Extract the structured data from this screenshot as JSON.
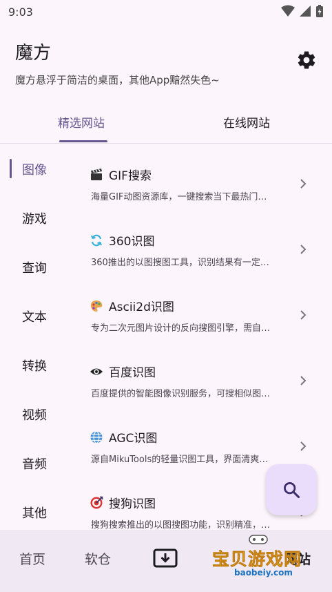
{
  "status_bar": {
    "time": "9:03"
  },
  "header": {
    "title": "魔方",
    "subtitle": "魔方悬浮于简洁的桌面，其他App黯然失色~"
  },
  "tabs": [
    {
      "label": "精选网站",
      "active": true
    },
    {
      "label": "在线网站",
      "active": false
    }
  ],
  "sidebar": {
    "items": [
      {
        "label": "图像",
        "active": true
      },
      {
        "label": "游戏"
      },
      {
        "label": "查询"
      },
      {
        "label": "文本"
      },
      {
        "label": "转换"
      },
      {
        "label": "视频"
      },
      {
        "label": "音频"
      },
      {
        "label": "其他"
      }
    ]
  },
  "list": [
    {
      "icon": "clapper-board-icon",
      "title": "GIF搜索",
      "desc": "海量GIF动图资源库，一键搜索当下最热门…"
    },
    {
      "icon": "refresh-arrows-icon",
      "title": "360识图",
      "desc": "360推出的以图搜图工具，识别结果有一定…"
    },
    {
      "icon": "artist-palette-icon",
      "title": "Ascii2d识图",
      "desc": "专为二次元图片设计的反向搜图引擎，需自…"
    },
    {
      "icon": "eye-icon",
      "title": "百度识图",
      "desc": "百度提供的智能图像识别服务，可搜相似图…"
    },
    {
      "icon": "globe-icon",
      "title": "AGC识图",
      "desc": "源自MikuTools的轻量识图工具，界面清爽…"
    },
    {
      "icon": "target-icon",
      "title": "搜狗识图",
      "desc": "搜狗搜索推出的以图搜图功能，识别精准，…"
    }
  ],
  "bottom_nav": [
    {
      "label": "首页"
    },
    {
      "label": "软仓"
    },
    {
      "label": "",
      "icon": "download-box-icon"
    },
    {
      "label": "网站",
      "active": true
    }
  ],
  "watermark": {
    "text": "宝贝游戏网",
    "url": "baobeiy.com"
  },
  "colors": {
    "accent": "#66558e",
    "fab_bg": "#e9ddfb",
    "bg": "#fcf6fc",
    "nav_bg": "#f0e9f4"
  }
}
